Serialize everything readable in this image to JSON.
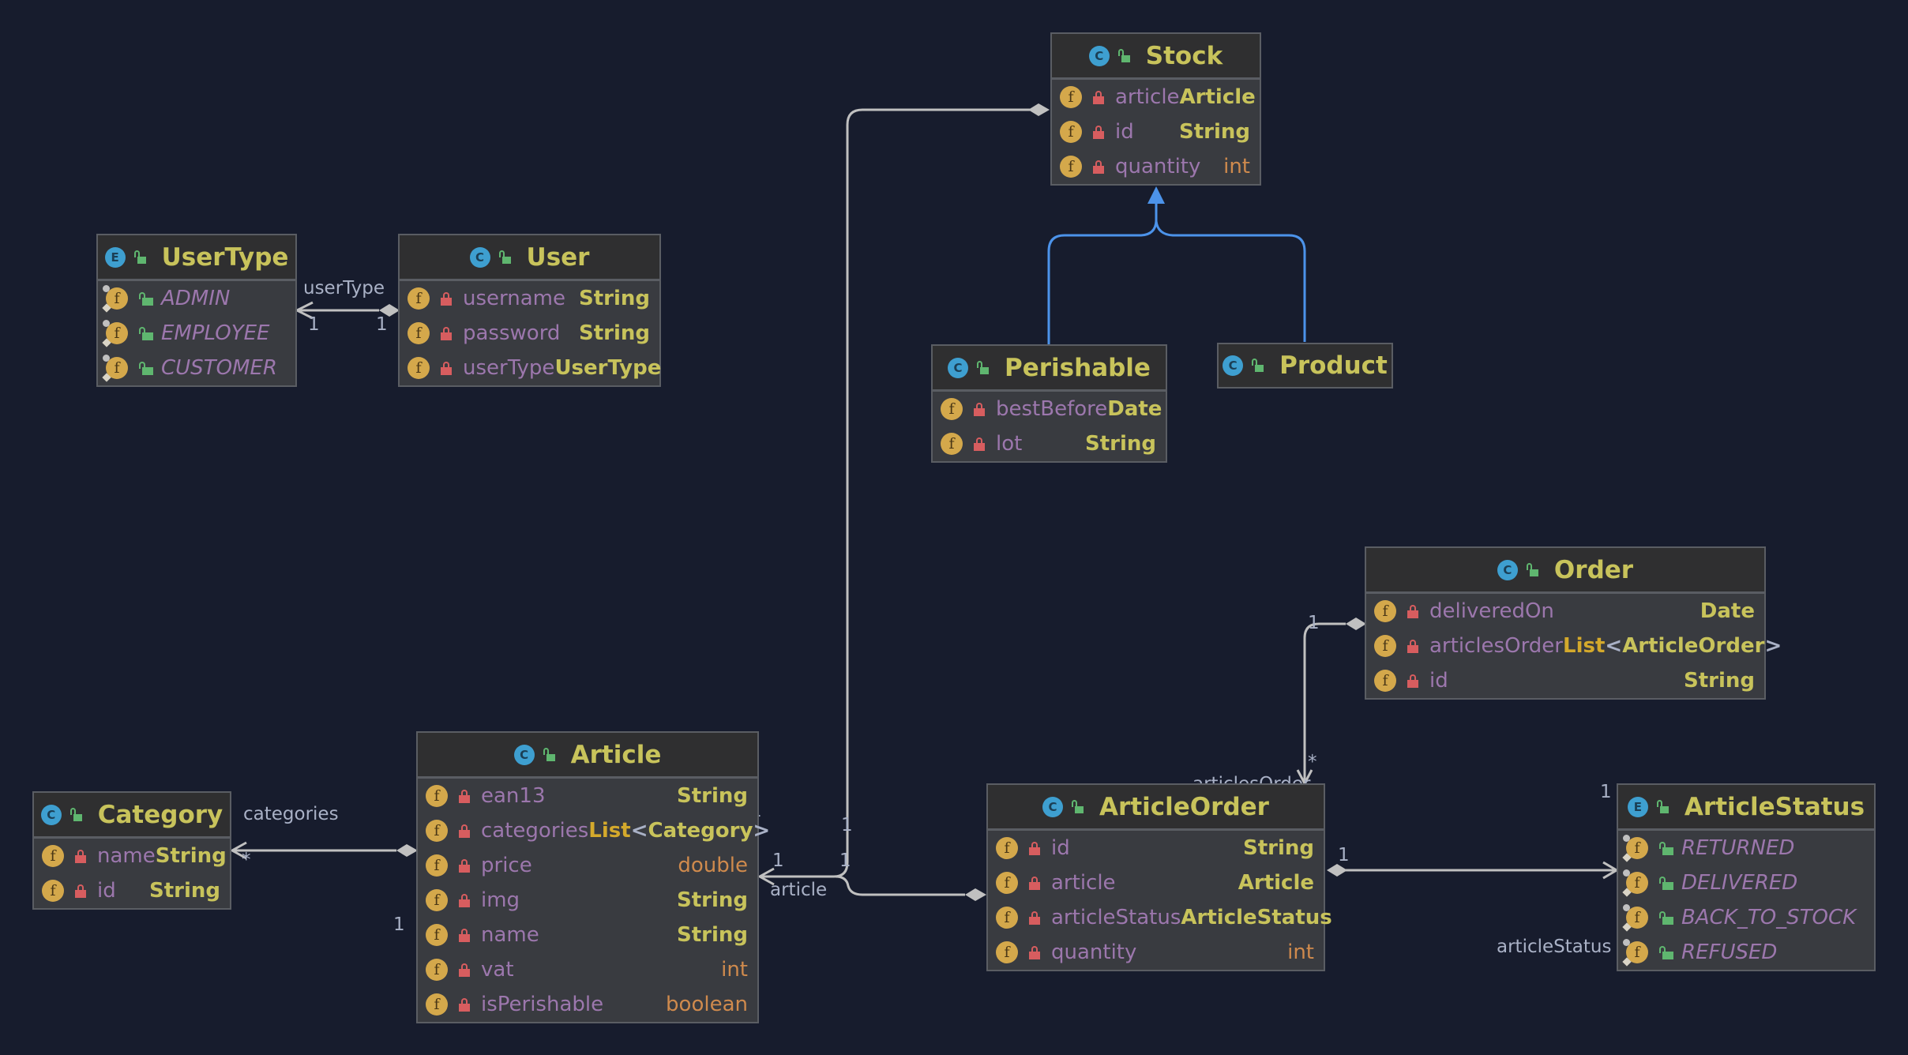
{
  "diagram": {
    "type": "uml-class-diagram",
    "colors": {
      "background": "#171c2d",
      "node_fill": "#393b40",
      "header_fill": "#2f2f30",
      "class_title": "#c8c35b",
      "field_name": "#9c77ad",
      "primitive_type": "#cf8a4d",
      "edge": "#c0c0c0",
      "inheritance_edge": "#4c93ea",
      "kind_badge": "#3e9fd0",
      "private_lock": "#d75d5f",
      "public_lock": "#5fb66f"
    },
    "nodes": {
      "stock": {
        "kind": "C",
        "name": "Stock",
        "fields": [
          {
            "name": "article",
            "type": "Article",
            "primitive": false
          },
          {
            "name": "id",
            "type": "String",
            "primitive": false
          },
          {
            "name": "quantity",
            "type": "int",
            "primitive": true
          }
        ]
      },
      "usertype": {
        "kind": "E",
        "name": "UserType",
        "constants": [
          "ADMIN",
          "EMPLOYEE",
          "CUSTOMER"
        ]
      },
      "user": {
        "kind": "C",
        "name": "User",
        "fields": [
          {
            "name": "username",
            "type": "String",
            "primitive": false
          },
          {
            "name": "password",
            "type": "String",
            "primitive": false
          },
          {
            "name": "userType",
            "type": "UserType",
            "primitive": false
          }
        ]
      },
      "perishable": {
        "kind": "C",
        "name": "Perishable",
        "fields": [
          {
            "name": "bestBefore",
            "type": "Date",
            "primitive": false
          },
          {
            "name": "lot",
            "type": "String",
            "primitive": false
          }
        ]
      },
      "product": {
        "kind": "C",
        "name": "Product",
        "fields": []
      },
      "order": {
        "kind": "C",
        "name": "Order",
        "fields": [
          {
            "name": "deliveredOn",
            "type": "Date",
            "primitive": false
          },
          {
            "name": "articlesOrder",
            "type": "List<ArticleOrder>",
            "generic": "List",
            "inner": "ArticleOrder"
          },
          {
            "name": "id",
            "type": "String",
            "primitive": false
          }
        ]
      },
      "category": {
        "kind": "C",
        "name": "Category",
        "fields": [
          {
            "name": "name",
            "type": "String",
            "primitive": false
          },
          {
            "name": "id",
            "type": "String",
            "primitive": false
          }
        ]
      },
      "article": {
        "kind": "C",
        "name": "Article",
        "fields": [
          {
            "name": "ean13",
            "type": "String",
            "primitive": false
          },
          {
            "name": "categories",
            "type": "List<Category>",
            "generic": "List",
            "inner": "Category"
          },
          {
            "name": "price",
            "type": "double",
            "primitive": true
          },
          {
            "name": "img",
            "type": "String",
            "primitive": false
          },
          {
            "name": "name",
            "type": "String",
            "primitive": false
          },
          {
            "name": "vat",
            "type": "int",
            "primitive": true
          },
          {
            "name": "isPerishable",
            "type": "boolean",
            "primitive": true
          }
        ]
      },
      "articleorder": {
        "kind": "C",
        "name": "ArticleOrder",
        "fields": [
          {
            "name": "id",
            "type": "String",
            "primitive": false
          },
          {
            "name": "article",
            "type": "Article",
            "primitive": false
          },
          {
            "name": "articleStatus",
            "type": "ArticleStatus",
            "primitive": false
          },
          {
            "name": "quantity",
            "type": "int",
            "primitive": true
          }
        ]
      },
      "articlestatus": {
        "kind": "E",
        "name": "ArticleStatus",
        "constants": [
          "RETURNED",
          "DELIVERED",
          "BACK_TO_STOCK",
          "REFUSED"
        ]
      }
    },
    "edges": [
      {
        "from": "User",
        "to": "UserType",
        "type": "composition",
        "label": "userType",
        "from_mult": "1",
        "to_mult": "1"
      },
      {
        "from": "Stock",
        "to": "Article",
        "type": "composition",
        "label": "article",
        "from_mult": "1",
        "to_mult": "1"
      },
      {
        "from": "Perishable",
        "to": "Stock",
        "type": "inheritance"
      },
      {
        "from": "Product",
        "to": "Stock",
        "type": "inheritance"
      },
      {
        "from": "Article",
        "to": "Category",
        "type": "composition",
        "label": "categories",
        "from_mult": "1",
        "to_mult": "*"
      },
      {
        "from": "ArticleOrder",
        "to": "Article",
        "type": "composition",
        "label": "article",
        "from_mult": "1",
        "to_mult": "1"
      },
      {
        "from": "Order",
        "to": "ArticleOrder",
        "type": "composition",
        "label": "articlesOrder",
        "from_mult": "1",
        "to_mult": "*"
      },
      {
        "from": "ArticleOrder",
        "to": "ArticleStatus",
        "type": "composition",
        "label": "articleStatus",
        "from_mult": "1",
        "to_mult": "1"
      }
    ],
    "labels": {
      "usertype_role": "userType",
      "usertype_m_to": "1",
      "usertype_m_from": "1",
      "categories_role": "categories",
      "categories_m_to": "*",
      "categories_m_from": "1",
      "article_role": "article",
      "article_m_a": "1",
      "article_m_b": "1",
      "article_m_c": "1",
      "article_m_d": "1",
      "articlesorder_role": "articlesOrder",
      "articlesorder_m_from": "1",
      "articlesorder_m_to": "*",
      "articlestatus_role": "articleStatus",
      "articlestatus_m_from": "1",
      "articlestatus_m_to": "1"
    }
  }
}
